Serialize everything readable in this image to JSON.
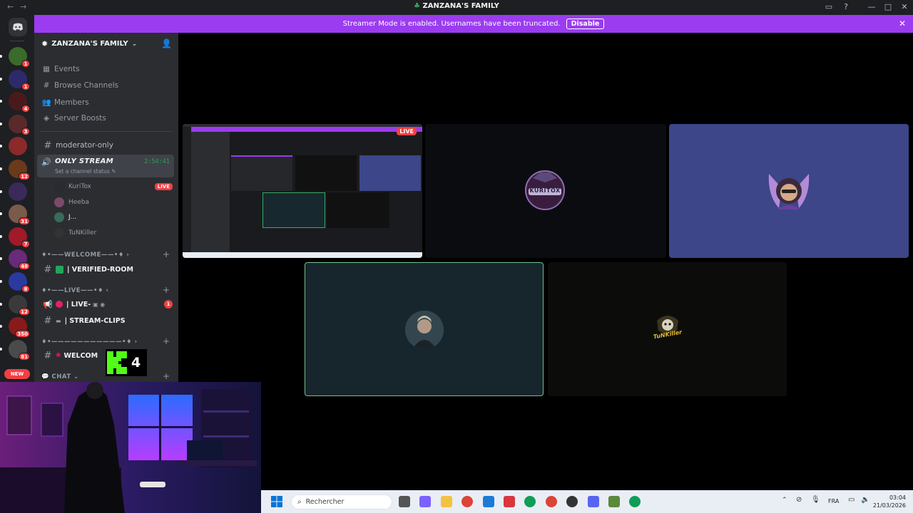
{
  "window": {
    "title": "ZANZANA'S FAMILY",
    "nav_back": "←",
    "nav_fwd": "→"
  },
  "banner": {
    "message": "Streamer Mode is enabled. Usernames have been truncated.",
    "disable_label": "Disable",
    "color": "#9b3cf0"
  },
  "rail": {
    "servers": [
      {
        "badge": "1"
      },
      {
        "badge": "1"
      },
      {
        "badge": "4"
      },
      {
        "badge": "3"
      },
      {
        "badge": ""
      },
      {
        "badge": "12"
      },
      {
        "badge": ""
      },
      {
        "badge": "31"
      },
      {
        "badge": "7"
      },
      {
        "badge": "48"
      },
      {
        "badge": "8"
      },
      {
        "badge": "12"
      },
      {
        "badge": "350"
      },
      {
        "badge": "81"
      }
    ],
    "new_label": "NEW"
  },
  "sidebar": {
    "server_name": "ZANZANA'S FAMILY",
    "menu": [
      {
        "label": "Events",
        "icon": "calendar-icon"
      },
      {
        "label": "Browse Channels",
        "icon": "hash-icon"
      },
      {
        "label": "Members",
        "icon": "members-icon"
      },
      {
        "label": "Server Boosts",
        "icon": "boost-icon"
      }
    ],
    "channels": {
      "moderator": "moderator-only",
      "stream_name": "ONLY STREAM",
      "stream_timer": "2:54:41",
      "stream_status": "Set a channel status"
    },
    "voice_users": [
      {
        "name": "KuriTox",
        "live": "LIVE"
      },
      {
        "name": "Heeba",
        "live": ""
      },
      {
        "name": "J...",
        "live": ""
      },
      {
        "name": "TuNKiller",
        "live": ""
      }
    ],
    "cat_welcome": "♦•——WELCOME——•♦",
    "verified_room": "| VERIFIED-ROOM",
    "cat_live": "♦•——LIVE——•♦",
    "live_channel": "| LIVE-",
    "live_badge": "1",
    "stream_clips": "| STREAM-CLIPS",
    "cat_sep": "♦•———————————•♦",
    "welcome_channel": "WELCOM",
    "cat_chat": "💬 CHAT"
  },
  "stage": {
    "live_label": "LIVE",
    "tiles": [
      {
        "label": "KURITOX"
      },
      {
        "label": ""
      },
      {
        "label": ""
      },
      {
        "label": "TuNKiller"
      }
    ]
  },
  "overlay": {
    "kick_count": "4"
  },
  "taskbar": {
    "search_placeholder": "Rechercher",
    "lang": "FRA",
    "time": "03:04",
    "date": "21/03/2026"
  }
}
